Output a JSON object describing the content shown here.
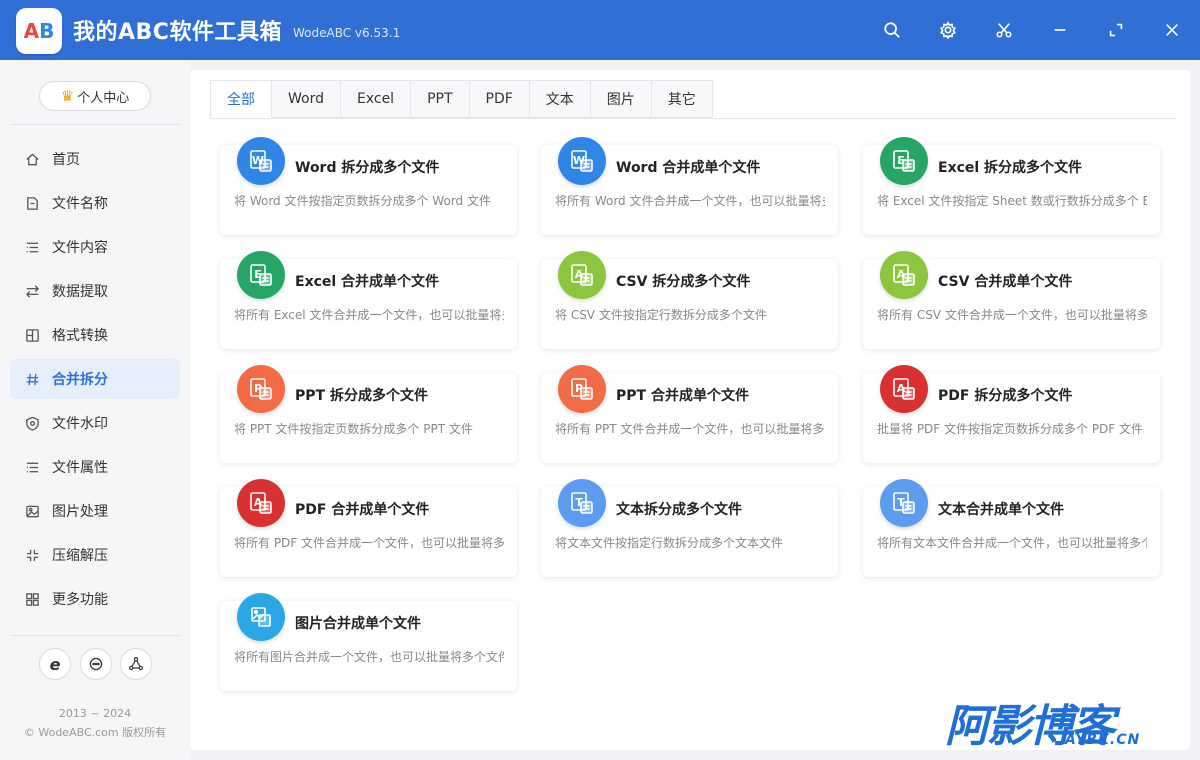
{
  "titlebar": {
    "logo_text_a": "A",
    "logo_text_b": "B",
    "title": "我的ABC软件工具箱",
    "version": "WodeABC v6.53.1",
    "icons": [
      "search-icon",
      "gear-icon",
      "scissors-icon",
      "minimize-icon",
      "maximize-icon",
      "close-icon"
    ],
    "color": "#2f6fd6"
  },
  "sidebar": {
    "personal_center": "个人中心",
    "items": [
      {
        "label": "首页",
        "icon": "home-icon"
      },
      {
        "label": "文件名称",
        "icon": "file-name-icon"
      },
      {
        "label": "文件内容",
        "icon": "file-content-icon"
      },
      {
        "label": "数据提取",
        "icon": "data-extract-icon"
      },
      {
        "label": "格式转换",
        "icon": "format-convert-icon"
      },
      {
        "label": "合并拆分",
        "icon": "merge-split-icon"
      },
      {
        "label": "文件水印",
        "icon": "watermark-icon"
      },
      {
        "label": "文件属性",
        "icon": "file-property-icon"
      },
      {
        "label": "图片处理",
        "icon": "image-process-icon"
      },
      {
        "label": "压缩解压",
        "icon": "compress-icon"
      },
      {
        "label": "更多功能",
        "icon": "more-functions-icon"
      }
    ],
    "active_index": 5,
    "round_buttons": [
      {
        "label": "e",
        "icon": "ie-icon"
      },
      {
        "label": "",
        "icon": "chat-icon"
      },
      {
        "label": "",
        "icon": "share-icon"
      }
    ],
    "copyright_years": "2013 ~ 2024",
    "copyright_text": "© WodeABC.com 版权所有"
  },
  "tabs": [
    "全部",
    "Word",
    "Excel",
    "PPT",
    "PDF",
    "文本",
    "图片",
    "其它"
  ],
  "active_tab": 0,
  "cards": [
    {
      "title": "Word 拆分成多个文件",
      "desc": "将 Word 文件按指定页数拆分成多个 Word 文件",
      "icon": "word-file-icon",
      "color": "#2f86e6",
      "letter": "W"
    },
    {
      "title": "Word 合并成单个文件",
      "desc": "将所有 Word 文件合并成一个文件，也可以批量将多个文件",
      "icon": "word-merge-icon",
      "color": "#2f86e6",
      "letter": "W"
    },
    {
      "title": "Excel 拆分成多个文件",
      "desc": "将 Excel 文件按指定 Sheet 数或行数拆分成多个 Excel 文件",
      "icon": "excel-file-icon",
      "color": "#27a567",
      "letter": "E"
    },
    {
      "title": "Excel 合并成单个文件",
      "desc": "将所有 Excel 文件合并成一个文件，也可以批量将多个文件",
      "icon": "excel-merge-icon",
      "color": "#27a567",
      "letter": "E"
    },
    {
      "title": "CSV 拆分成多个文件",
      "desc": "将 CSV 文件按指定行数拆分成多个文件",
      "icon": "csv-file-icon",
      "color": "#8cc63e",
      "letter": "A"
    },
    {
      "title": "CSV 合并成单个文件",
      "desc": "将所有 CSV 文件合并成一个文件，也可以批量将多个文件",
      "icon": "csv-merge-icon",
      "color": "#8cc63e",
      "letter": "A"
    },
    {
      "title": "PPT 拆分成多个文件",
      "desc": "将 PPT 文件按指定页数拆分成多个 PPT 文件",
      "icon": "ppt-file-icon",
      "color": "#f26b45",
      "letter": "P"
    },
    {
      "title": "PPT 合并成单个文件",
      "desc": "将所有 PPT 文件合并成一个文件，也可以批量将多个文件",
      "icon": "ppt-merge-icon",
      "color": "#f26b45",
      "letter": "P"
    },
    {
      "title": "PDF 拆分成多个文件",
      "desc": "批量将 PDF 文件按指定页数拆分成多个 PDF 文件",
      "icon": "pdf-file-icon",
      "color": "#d93030",
      "letter": "A"
    },
    {
      "title": "PDF 合并成单个文件",
      "desc": "将所有 PDF 文件合并成一个文件，也可以批量将多个文件",
      "icon": "pdf-merge-icon",
      "color": "#d93030",
      "letter": "A"
    },
    {
      "title": "文本拆分成多个文件",
      "desc": "将文本文件按指定行数拆分成多个文本文件",
      "icon": "text-file-icon",
      "color": "#5b9bf0",
      "letter": "T"
    },
    {
      "title": "文本合并成单个文件",
      "desc": "将所有文本文件合并成一个文件，也可以批量将多个文件",
      "icon": "text-merge-icon",
      "color": "#5b9bf0",
      "letter": "T"
    },
    {
      "title": "图片合并成单个文件",
      "desc": "将所有图片合并成一个文件，也可以批量将多个文件",
      "icon": "image-merge-icon",
      "color": "#2aa7e6",
      "letter": ""
    }
  ],
  "watermark": {
    "cn": "阿影博客",
    "en": "AYBK.CN"
  }
}
